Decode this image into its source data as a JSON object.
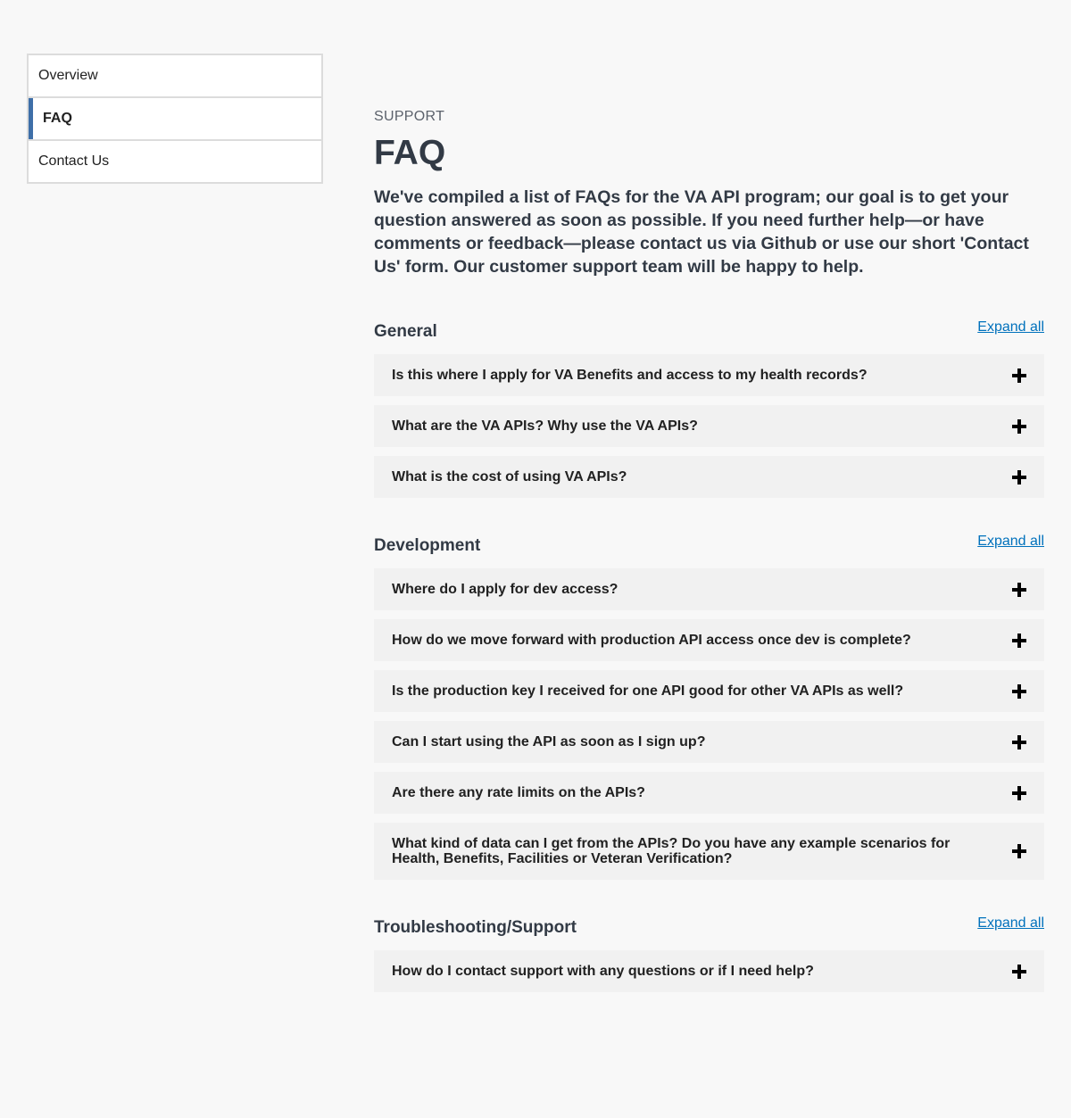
{
  "sidenav": {
    "items": [
      {
        "label": "Overview"
      },
      {
        "label": "FAQ"
      },
      {
        "label": "Contact Us"
      }
    ]
  },
  "header": {
    "eyebrow": "SUPPORT",
    "title": "FAQ",
    "intro": "We've compiled a list of FAQs for the VA API program; our goal is to get your question answered as soon as possible. If you need further help—or have comments or feedback—please contact us via Github or use our short 'Contact Us' form. Our customer support team will be happy to help."
  },
  "sections": [
    {
      "title": "General",
      "expand_label": "Expand all",
      "questions": [
        "Is this where I apply for VA Benefits and access to my health records?",
        "What are the VA APIs? Why use the VA APIs?",
        "What is the cost of using VA APIs?"
      ]
    },
    {
      "title": "Development",
      "expand_label": "Expand all",
      "questions": [
        "Where do I apply for dev access?",
        "How do we move forward with production API access once dev is complete?",
        "Is the production key I received for one API good for other VA APIs as well?",
        "Can I start using the API as soon as I sign up?",
        "Are there any rate limits on the APIs?",
        "What kind of data can I get from the APIs? Do you have any example scenarios for Health, Benefits, Facilities or Veteran Verification?"
      ]
    },
    {
      "title": "Troubleshooting/Support",
      "expand_label": "Expand all",
      "questions": [
        "How do I contact support with any questions or if I need help?"
      ]
    }
  ],
  "icons": {
    "accordion_toggle": "plus-icon"
  },
  "colors": {
    "accent": "#3e6fa8",
    "link": "#0071bc",
    "accordion_bg": "#f1f1f1"
  }
}
